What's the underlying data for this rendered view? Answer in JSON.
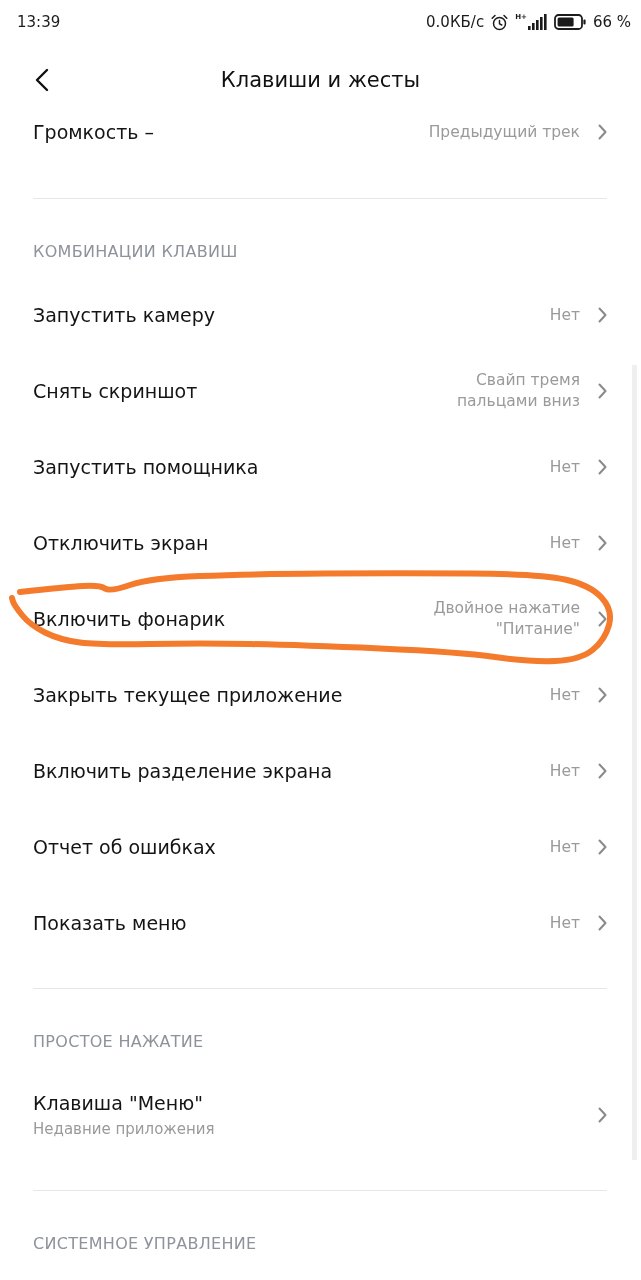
{
  "status_bar": {
    "time": "13:39",
    "network_speed": "0.0КБ/с",
    "network_type": "H+",
    "battery": "66 %"
  },
  "header": {
    "title": "Клавиши и жесты"
  },
  "top_items": [
    {
      "title": "Громкость –",
      "value": "Предыдущий трек",
      "circled": false
    }
  ],
  "sections": [
    {
      "title": "КОМБИНАЦИИ КЛАВИШ",
      "items": [
        {
          "title": "Запустить камеру",
          "value": "Нет",
          "circled": false
        },
        {
          "title": "Снять скриншот",
          "value": "Свайп тремя пальцами вниз",
          "circled": false
        },
        {
          "title": "Запустить помощника",
          "value": "Нет",
          "circled": false
        },
        {
          "title": "Отключить экран",
          "value": "Нет",
          "circled": false
        },
        {
          "title": "Включить фонарик",
          "value": "Двойное нажатие \"Питание\"",
          "circled": true
        },
        {
          "title": "Закрыть текущее приложение",
          "value": "Нет",
          "circled": false
        },
        {
          "title": "Включить разделение экрана",
          "value": "Нет",
          "circled": false
        },
        {
          "title": "Отчет об ошибках",
          "value": "Нет",
          "circled": false
        },
        {
          "title": "Показать меню",
          "value": "Нет",
          "circled": false
        }
      ]
    },
    {
      "title": "ПРОСТОЕ НАЖАТИЕ",
      "items": [
        {
          "title": "Клавиша \"Меню\"",
          "subtitle": "Недавние приложения",
          "circled": false
        }
      ]
    },
    {
      "title": "СИСТЕМНОЕ УПРАВЛЕНИЕ"
    }
  ]
}
